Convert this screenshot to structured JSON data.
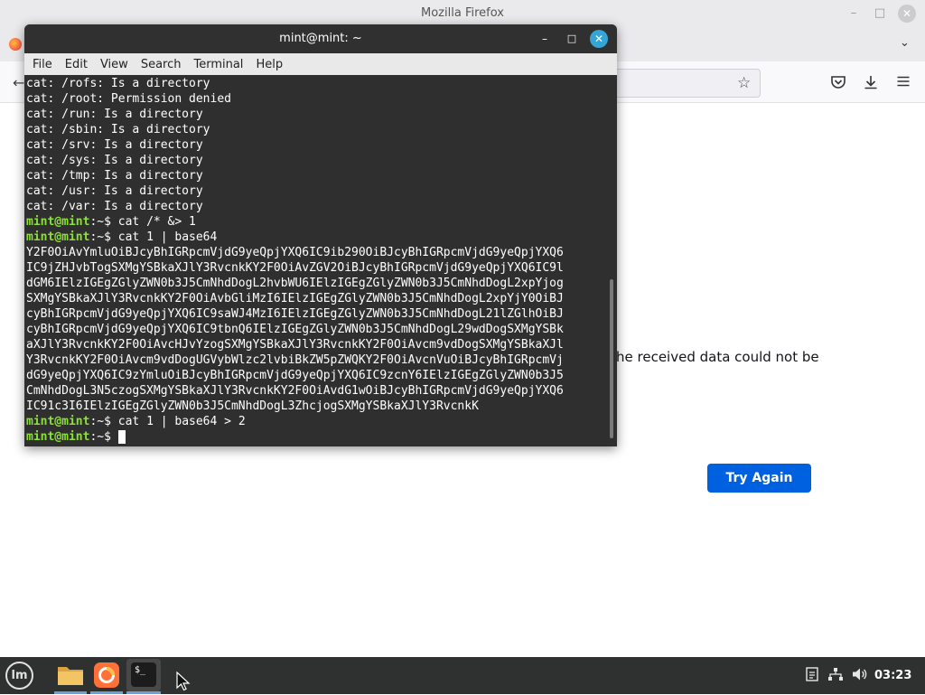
{
  "firefox": {
    "window_title": "Mozilla Firefox",
    "minimize_glyph": "–",
    "maximize_glyph": "□",
    "close_glyph": "✕",
    "tab_list_glyph": "⌄",
    "back_glyph": "←",
    "star_glyph": "☆",
    "error_text": "he received data could not be",
    "try_again_label": "Try Again"
  },
  "terminal": {
    "title": "mint@mint: ~",
    "minimize_glyph": "–",
    "maximize_glyph": "□",
    "close_glyph": "✕",
    "menu": [
      "File",
      "Edit",
      "View",
      "Search",
      "Terminal",
      "Help"
    ],
    "prompt_user": "mint@mint",
    "prompt_suffix": ":~$",
    "output_lines_top": [
      "cat: /rofs: Is a directory",
      "cat: /root: Permission denied",
      "cat: /run: Is a directory",
      "cat: /sbin: Is a directory",
      "cat: /srv: Is a directory",
      "cat: /sys: Is a directory",
      "cat: /tmp: Is a directory",
      "cat: /usr: Is a directory",
      "cat: /var: Is a directory"
    ],
    "command_1": " cat /* &> 1",
    "command_2": " cat 1 | base64",
    "base64_lines": [
      "Y2F0OiAvYmluOiBJcyBhIGRpcmVjdG9yeQpjYXQ6IC9ib290OiBJcyBhIGRpcmVjdG9yeQpjYXQ6",
      "IC9jZHJvbTogSXMgYSBkaXJlY3RvcnkKY2F0OiAvZGV2OiBJcyBhIGRpcmVjdG9yeQpjYXQ6IC9l",
      "dGM6IElzIGEgZGlyZWN0b3J5CmNhdDogL2hvbWU6IElzIGEgZGlyZWN0b3J5CmNhdDogL2xpYjog",
      "SXMgYSBkaXJlY3RvcnkKY2F0OiAvbGliMzI6IElzIGEgZGlyZWN0b3J5CmNhdDogL2xpYjY0OiBJ",
      "cyBhIGRpcmVjdG9yeQpjYXQ6IC9saWJ4MzI6IElzIGEgZGlyZWN0b3J5CmNhdDogL21lZGlhOiBJ",
      "cyBhIGRpcmVjdG9yeQpjYXQ6IC9tbnQ6IElzIGEgZGlyZWN0b3J5CmNhdDogL29wdDogSXMgYSBk",
      "aXJlY3RvcnkKY2F0OiAvcHJvYzogSXMgYSBkaXJlY3RvcnkKY2F0OiAvcm9vdDogSXMgYSBkaXJl",
      "Y3RvcnkKY2F0OiAvcm9vdDogUGVybWlzc2lvbiBkZW5pZWQKY2F0OiAvcnVuOiBJcyBhIGRpcmVj",
      "dG9yeQpjYXQ6IC9zYmluOiBJcyBhIGRpcmVjdG9yeQpjYXQ6IC9zcnY6IElzIGEgZGlyZWN0b3J5",
      "CmNhdDogL3N5czogSXMgYSBkaXJlY3RvcnkKY2F0OiAvdG1wOiBJcyBhIGRpcmVjdG9yeQpjYXQ6",
      "IC91c3I6IElzIGEgZGlyZWN0b3J5CmNhdDogL3ZhcjogSXMgYSBkaXJlY3RvcnkK"
    ],
    "command_3": " cat 1 | base64 > 2",
    "command_4": " ",
    "colors": {
      "background": "#2f2f2f",
      "prompt": "#8ae234",
      "text": "#ffffff",
      "close_button": "#35a4d6"
    }
  },
  "taskbar": {
    "menu_button_label": "lm",
    "terminal_icon_label": "$_",
    "tray_icons": [
      "notes-icon",
      "network-icon",
      "volume-icon"
    ],
    "clock": "03:23",
    "colors": {
      "background": "#2f3030",
      "active_underline": "#6aa1d6"
    }
  }
}
